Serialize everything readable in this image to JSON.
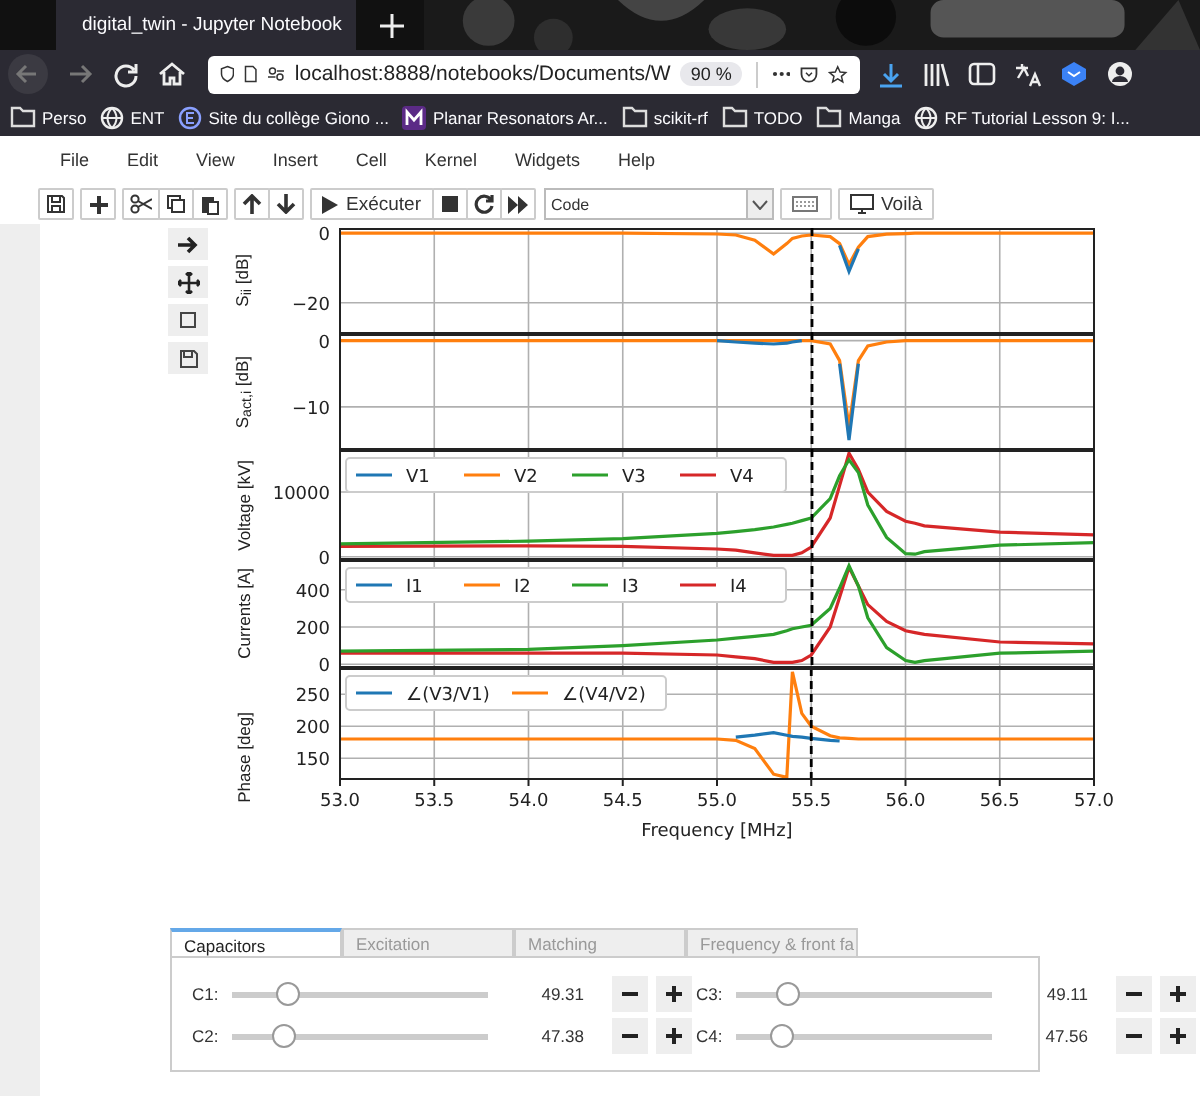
{
  "browser": {
    "tabs": [
      {
        "title": "digital_twin - Jupyter Notebook",
        "selected": true
      }
    ],
    "address": "localhost:8888/notebooks/Documents/W",
    "zoom": "90 %",
    "bookmarks": [
      {
        "kind": "folder",
        "label": "Perso"
      },
      {
        "kind": "globe",
        "label": "ENT"
      },
      {
        "kind": "site",
        "label": "Site du collège Giono ..."
      },
      {
        "kind": "letter",
        "label": "Planar Resonators Ar..."
      },
      {
        "kind": "folder",
        "label": "scikit-rf"
      },
      {
        "kind": "folder",
        "label": "TODO"
      },
      {
        "kind": "folder",
        "label": "Manga"
      },
      {
        "kind": "globe",
        "label": "RF Tutorial Lesson 9: I..."
      }
    ]
  },
  "menu": [
    "File",
    "Edit",
    "View",
    "Insert",
    "Cell",
    "Kernel",
    "Widgets",
    "Help"
  ],
  "toolbar": {
    "run_label": "Exécuter",
    "cell_type": "Code",
    "voila_label": "Voilà"
  },
  "figure": {
    "subplots": [
      {
        "chart_data": {
          "type": "line",
          "ylabel": "S$_{ii}$ [dB]",
          "grid": true,
          "x": [
            53.0,
            54.0,
            54.5,
            55.0,
            55.1,
            55.2,
            55.3,
            55.37,
            55.4,
            55.45,
            55.5,
            55.6,
            55.65,
            55.7,
            55.75,
            55.8,
            55.9,
            56.0,
            56.05,
            56.1,
            56.5,
            57.0
          ],
          "xlim": [
            53,
            57
          ],
          "ylim": [
            -29,
            1.5
          ],
          "yticks": [
            {
              "value": 0,
              "label": "0"
            },
            {
              "value": -20,
              "label": "−20"
            }
          ],
          "series": [
            {
              "color": "#1f77b4",
              "values": [
                null,
                null,
                null,
                null,
                null,
                null,
                null,
                null,
                null,
                null,
                null,
                null,
                -3.5,
                -11,
                -4.5,
                null,
                null,
                null,
                null,
                null,
                null,
                null
              ]
            },
            {
              "color": "#ff7f0e",
              "values": [
                0,
                0,
                0,
                -0.2,
                -0.5,
                -2,
                -6,
                -3,
                -1.5,
                -0.8,
                -0.5,
                -1,
                -3,
                -9,
                -4,
                -1,
                -0.3,
                -0.1,
                0,
                0,
                0,
                0
              ]
            }
          ]
        }
      },
      {
        "chart_data": {
          "type": "line",
          "ylabel": "S$_{act,i}$ [dB]",
          "grid": true,
          "x": [
            53.0,
            54.0,
            54.5,
            55.0,
            55.1,
            55.2,
            55.3,
            55.37,
            55.4,
            55.45,
            55.5,
            55.6,
            55.65,
            55.7,
            55.75,
            55.8,
            55.9,
            56.0,
            56.05,
            56.1,
            56.5,
            57.0
          ],
          "xlim": [
            53,
            57
          ],
          "ylim": [
            -16.5,
            1
          ],
          "yticks": [
            {
              "value": 0,
              "label": "0"
            },
            {
              "value": -10,
              "label": "−10"
            }
          ],
          "series": [
            {
              "color": "#1f77b4",
              "values": [
                null,
                null,
                null,
                0,
                -0.2,
                -0.4,
                -0.5,
                -0.4,
                -0.2,
                0,
                null,
                null,
                -3.5,
                -15,
                -3.5,
                null,
                null,
                null,
                null,
                null,
                null,
                null
              ]
            },
            {
              "color": "#ff7f0e",
              "values": [
                0,
                0,
                0,
                0,
                0,
                0,
                0,
                0,
                0,
                0,
                0,
                -0.5,
                -3,
                -13,
                -3,
                -0.8,
                -0.2,
                0,
                0,
                0,
                0,
                0
              ]
            }
          ]
        }
      },
      {
        "chart_data": {
          "type": "line",
          "ylabel": "Voltage [kV]",
          "grid": true,
          "legend": true,
          "x": [
            53.0,
            54.0,
            54.5,
            55.0,
            55.1,
            55.2,
            55.3,
            55.37,
            55.4,
            55.45,
            55.5,
            55.6,
            55.65,
            55.7,
            55.75,
            55.8,
            55.9,
            56.0,
            56.05,
            56.1,
            56.5,
            57.0
          ],
          "xlim": [
            53,
            57
          ],
          "ylim": [
            -500,
            16500
          ],
          "yticks": [
            0,
            10000
          ],
          "series": [
            {
              "name": "V1",
              "color": "#1f77b4",
              "values": [
                null,
                null,
                null,
                null,
                null,
                null,
                null,
                null,
                null,
                null,
                null,
                null,
                null,
                null,
                null,
                null,
                null,
                null,
                null,
                null,
                null,
                null
              ]
            },
            {
              "name": "V2",
              "color": "#ff7f0e",
              "values": [
                null,
                null,
                null,
                null,
                null,
                null,
                null,
                null,
                null,
                null,
                null,
                null,
                null,
                null,
                null,
                null,
                null,
                null,
                null,
                null,
                null,
                null
              ]
            },
            {
              "name": "V3",
              "color": "#2ca02c",
              "values": [
                2000,
                2400,
                2800,
                3600,
                3900,
                4200,
                4600,
                5000,
                5200,
                5600,
                6000,
                9000,
                12500,
                15000,
                13000,
                8000,
                3000,
                500,
                400,
                800,
                1800,
                2200
              ]
            },
            {
              "name": "V4",
              "color": "#d62728",
              "values": [
                1600,
                1700,
                1600,
                1200,
                1000,
                600,
                200,
                200,
                200,
                600,
                1500,
                6000,
                11000,
                16000,
                13500,
                10000,
                7000,
                5500,
                5200,
                4800,
                3800,
                3400
              ]
            }
          ]
        }
      },
      {
        "chart_data": {
          "type": "line",
          "ylabel": "Currents [A]",
          "grid": true,
          "legend": true,
          "x": [
            53.0,
            54.0,
            54.5,
            55.0,
            55.1,
            55.2,
            55.3,
            55.37,
            55.4,
            55.45,
            55.5,
            55.6,
            55.65,
            55.7,
            55.75,
            55.8,
            55.9,
            56.0,
            56.05,
            56.1,
            56.5,
            57.0
          ],
          "xlim": [
            53,
            57
          ],
          "ylim": [
            -20,
            560
          ],
          "yticks": [
            0,
            200,
            400
          ],
          "series": [
            {
              "name": "I1",
              "color": "#1f77b4",
              "values": [
                null,
                null,
                null,
                null,
                null,
                null,
                null,
                null,
                null,
                null,
                null,
                null,
                null,
                null,
                null,
                null,
                null,
                null,
                null,
                null,
                null,
                null
              ]
            },
            {
              "name": "I2",
              "color": "#ff7f0e",
              "values": [
                null,
                null,
                null,
                null,
                null,
                null,
                null,
                null,
                null,
                null,
                null,
                null,
                null,
                null,
                null,
                null,
                null,
                null,
                null,
                null,
                null,
                null
              ]
            },
            {
              "name": "I3",
              "color": "#2ca02c",
              "values": [
                70,
                80,
                100,
                130,
                140,
                150,
                160,
                180,
                190,
                200,
                210,
                300,
                410,
                530,
                420,
                250,
                90,
                20,
                10,
                20,
                60,
                70
              ]
            },
            {
              "name": "I4",
              "color": "#d62728",
              "values": [
                60,
                60,
                60,
                50,
                40,
                30,
                10,
                10,
                10,
                20,
                50,
                200,
                360,
                520,
                420,
                320,
                230,
                180,
                170,
                160,
                120,
                110
              ]
            }
          ]
        }
      },
      {
        "chart_data": {
          "type": "line",
          "ylabel": "Phase [deg]",
          "xlabel": "Frequency [MHz]",
          "grid": true,
          "legend": true,
          "x": [
            53.0,
            54.0,
            54.5,
            55.0,
            55.1,
            55.2,
            55.3,
            55.37,
            55.4,
            55.45,
            55.5,
            55.6,
            55.65,
            55.7,
            55.75,
            55.8,
            55.9,
            56.0,
            56.05,
            56.1,
            56.5,
            57.0
          ],
          "xlim": [
            53,
            57
          ],
          "ylim": [
            116,
            291
          ],
          "yticks": [
            150,
            200,
            250
          ],
          "xticks": [
            {
              "value": 53,
              "label": "53.0"
            },
            {
              "value": 53.5,
              "label": "53.5"
            },
            {
              "value": 54,
              "label": "54.0"
            },
            {
              "value": 54.5,
              "label": "54.5"
            },
            {
              "value": 55,
              "label": "55.0"
            },
            {
              "value": 55.5,
              "label": "55.5"
            },
            {
              "value": 56,
              "label": "56.0"
            },
            {
              "value": 56.5,
              "label": "56.5"
            },
            {
              "value": 57,
              "label": "57.0"
            }
          ],
          "ref_lines": [
            {
              "axis": "x",
              "value": 55.5
            }
          ],
          "series": [
            {
              "name": "∠(V3/V1)",
              "color": "#1f77b4",
              "values": [
                null,
                null,
                null,
                null,
                183,
                186,
                190,
                186,
                184,
                183,
                181,
                178,
                177,
                null,
                null,
                null,
                null,
                null,
                null,
                null,
                null,
                null
              ]
            },
            {
              "name": "∠(V4/V2)",
              "color": "#ff7f0e",
              "values": [
                180,
                180,
                180,
                180,
                178,
                165,
                125,
                120,
                285,
                220,
                200,
                185,
                182,
                181,
                180,
                180,
                180,
                180,
                180,
                180,
                180,
                180
              ]
            }
          ]
        }
      }
    ]
  },
  "widget": {
    "tabs": [
      {
        "label": "Capacitors",
        "selected": true
      },
      {
        "label": "Excitation",
        "selected": false
      },
      {
        "label": "Matching",
        "selected": false
      },
      {
        "label": "Frequency & front fa",
        "selected": false
      }
    ],
    "sliders": [
      {
        "label": "C1:",
        "level": 0.22,
        "value": "49.31"
      },
      {
        "label": "C3:",
        "level": 0.2,
        "value": "49.11"
      },
      {
        "label": "C2:",
        "level": 0.2,
        "value": "47.38"
      },
      {
        "label": "C4:",
        "level": 0.18,
        "value": "47.56"
      }
    ]
  }
}
